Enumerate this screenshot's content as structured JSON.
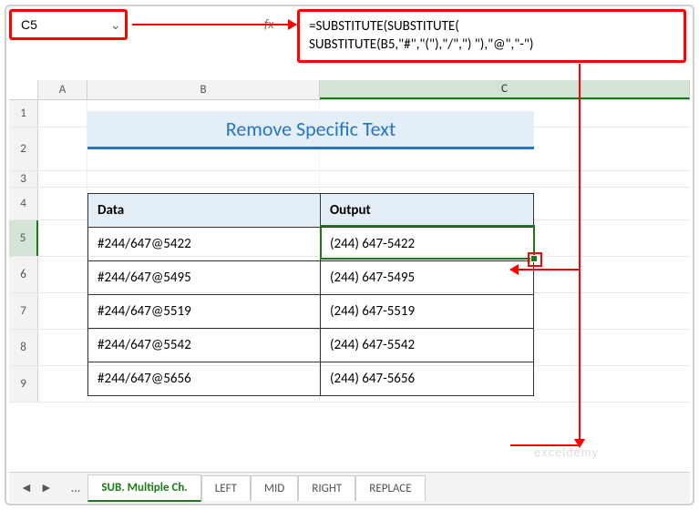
{
  "nameBox": "C5",
  "formula_line1": "=SUBSTITUTE(SUBSTITUTE(",
  "formula_line2": "SUBSTITUTE(B5,\"#\",\"(\"),\"/\",\") \"),\"@\",\"-\")",
  "fx": "fx",
  "cols": {
    "a": "A",
    "b": "B",
    "c": "C"
  },
  "rownums": [
    "1",
    "2",
    "3",
    "4",
    "5",
    "6",
    "7",
    "8",
    "9"
  ],
  "title": "Remove Specific Text",
  "headers": {
    "data": "Data",
    "output": "Output"
  },
  "table": [
    {
      "data": "#244/647@5422",
      "output": "(244) 647-5422"
    },
    {
      "data": "#244/647@5495",
      "output": "(244) 647-5495"
    },
    {
      "data": "#244/647@5519",
      "output": "(244) 647-5519"
    },
    {
      "data": "#244/647@5542",
      "output": "(244) 647-5542"
    },
    {
      "data": "#244/647@5656",
      "output": "(244) 647-5656"
    }
  ],
  "tabs": {
    "nav_prev": "◄",
    "nav_next": "►",
    "dots": "...",
    "active": "SUB. Multiple Ch.",
    "t2": "LEFT",
    "t3": "MID",
    "t4": "RIGHT",
    "t5": "REPLACE"
  },
  "watermark": "exceldemy"
}
